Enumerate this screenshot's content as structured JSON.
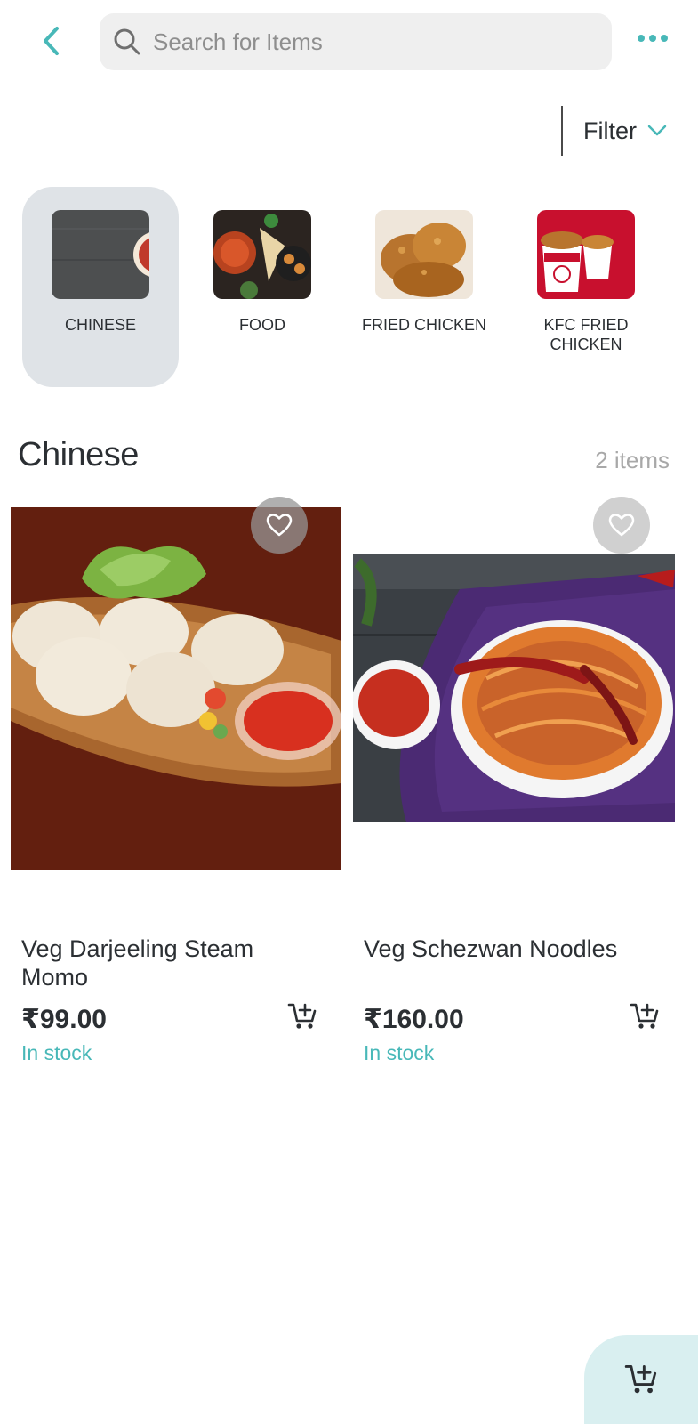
{
  "header": {
    "back_icon": "chevron-left-icon",
    "search_placeholder": "Search for Items",
    "search_value": "",
    "more_icon": "more-horizontal-icon"
  },
  "filter": {
    "label": "Filter",
    "icon": "chevron-down-icon"
  },
  "categories": [
    {
      "label": "CHINESE",
      "selected": true
    },
    {
      "label": "FOOD",
      "selected": false
    },
    {
      "label": "FRIED CHICKEN",
      "selected": false
    },
    {
      "label": "KFC FRIED CHICKEN",
      "selected": false
    }
  ],
  "section": {
    "title": "Chinese",
    "count": "2 items"
  },
  "products": [
    {
      "title": "Veg Darjeeling Steam Momo",
      "price": "₹99.00",
      "stock": "In stock"
    },
    {
      "title": "Veg Schezwan Noodles",
      "price": "₹160.00",
      "stock": "In stock"
    }
  ],
  "colors": {
    "accent": "#48b8b8",
    "selected_category_bg": "#dfe3e7",
    "search_bg": "#efefef",
    "fab_bg": "#d9eff0"
  }
}
